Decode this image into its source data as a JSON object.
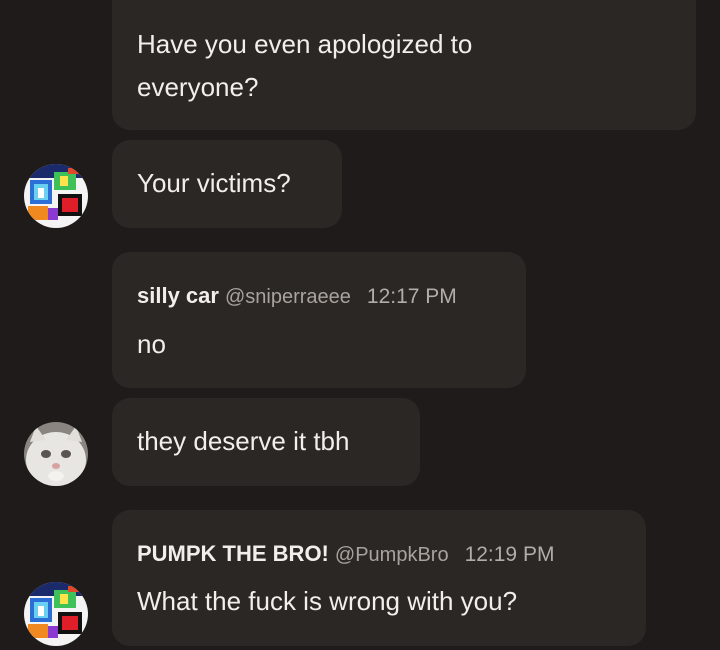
{
  "messages": [
    {
      "text_line1": "Have you even apologized to",
      "text_line2": "everyone?"
    },
    {
      "text": "Your victims?",
      "avatar_icon": "pixel-art-avatar"
    },
    {
      "author": "silly car",
      "handle": "@sniperraeee",
      "time": "12:17 PM",
      "text": "no"
    },
    {
      "text": "they deserve it tbh",
      "avatar_icon": "white-cat-avatar"
    },
    {
      "author": "PUMPK THE BRO!",
      "handle": "@PumpkBro",
      "time": "12:19 PM",
      "text": "What the fuck is wrong with you?",
      "avatar_icon": "pixel-art-avatar"
    }
  ],
  "colors": {
    "background": "#1e1b1a",
    "bubble": "#2b2725",
    "text": "#f2eeea",
    "muted": "#a9a29d"
  }
}
